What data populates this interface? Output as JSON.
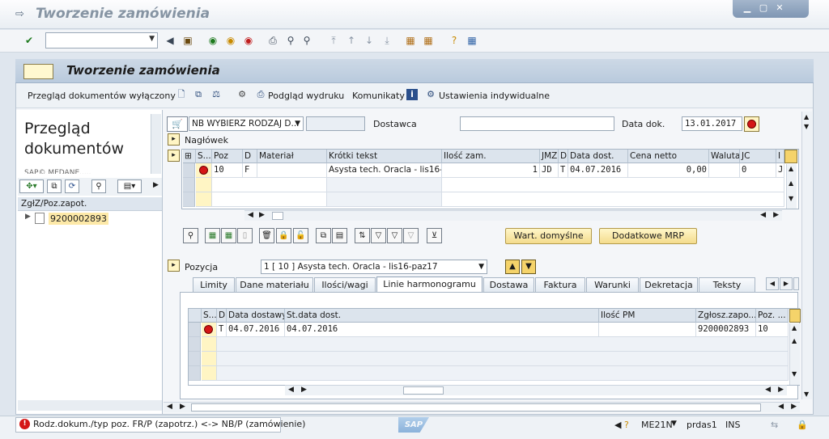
{
  "window": {
    "title": "Tworzenie zamówienia"
  },
  "system_toolbar": {
    "command_field_value": ""
  },
  "app": {
    "title": "Tworzenie zamówienia",
    "toolbar": {
      "doc_overview": "Przegląd dokumentów wyłączony",
      "print_preview": "Podgląd wydruku",
      "messages": "Komunikaty",
      "personal_settings": "Ustawienia indywidualne"
    }
  },
  "left_pane": {
    "title": "Przegląd dokumentów",
    "clipped_text": "SAP© MEDANE.....",
    "tree_header": "ZgłZ/Poz.zapot.",
    "tree_items": [
      "9200002893"
    ]
  },
  "header_area": {
    "doc_type": "NB WYBIERZ RODZAJ D...",
    "supplier_label": "Dostawca",
    "supplier_value": "",
    "doc_date_label": "Data dok.",
    "doc_date_value": "13.01.2017",
    "header_label": "Nagłówek"
  },
  "items_grid": {
    "columns": [
      "S...",
      "Poz",
      "D",
      "Materiał",
      "Krótki tekst",
      "Ilość zam.",
      "JMZ",
      "D",
      "Data dost.",
      "Cena netto",
      "Waluta",
      "JC",
      "I"
    ],
    "rows": [
      {
        "poz": "10",
        "d": "F",
        "material": "",
        "text": "Asysta tech. Oracla - lis16-...",
        "qty": "1",
        "jmz": "JD",
        "d2": "T",
        "date": "04.07.2016",
        "price": "0,00",
        "currency": "",
        "jc": "0",
        "i": "JI"
      }
    ]
  },
  "buttons": {
    "default_values": "Wart. domyślne",
    "additional_mrp": "Dodatkowe MRP"
  },
  "position": {
    "label": "Pozycja",
    "value": "1 [ 10 ] Asysta tech. Oracla - lis16-paz17"
  },
  "tabs": [
    "Limity",
    "Dane materiału",
    "Ilości/wagi",
    "Linie harmonogramu",
    "Dostawa",
    "Faktura",
    "Warunki",
    "Dekretacja",
    "Teksty"
  ],
  "active_tab": "Linie harmonogramu",
  "schedule_grid": {
    "columns": [
      "S...",
      "D",
      "Data dostawy",
      "St.data dost.",
      "Ilość PM",
      "Zgłosz.zapo...",
      "Poz. ..."
    ],
    "rows": [
      {
        "d": "T",
        "date": "04.07.2016",
        "stat_date": "04.07.2016",
        "qty": "",
        "req": "9200002893",
        "pos": "10"
      }
    ]
  },
  "statusbar": {
    "message": "Rodz.dokum./typ poz. FR/P (zapotrz.) <-> NB/P (zamówienie)",
    "logo": "SAP",
    "transaction": "ME21N",
    "server": "prdas1",
    "mode": "INS"
  }
}
